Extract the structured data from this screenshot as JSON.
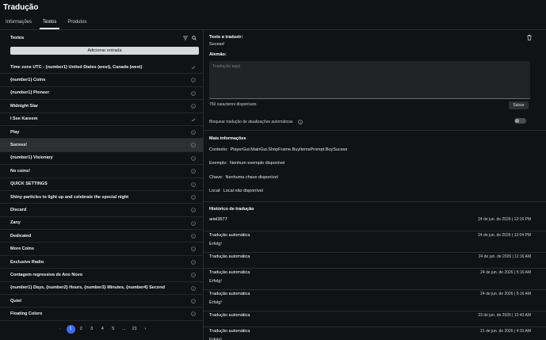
{
  "app": {
    "title": "Tradução"
  },
  "tabs": [
    {
      "label": "Informações"
    },
    {
      "label": "Textos"
    },
    {
      "label": "Produtos"
    }
  ],
  "left": {
    "header": "Textos",
    "add_button": "Adicionar entrada",
    "rows": [
      {
        "label": "Time zone UTC - {number1} United States (west), Canada (west)",
        "icon": "check-icon"
      },
      {
        "label": "{number1} Coins",
        "icon": "info-icon"
      },
      {
        "label": "{number1} Pioneer",
        "icon": "info-icon"
      },
      {
        "label": "Midnight Star",
        "icon": "info-icon"
      },
      {
        "label": "I See Kareem",
        "icon": "check-icon"
      },
      {
        "label": "Play",
        "icon": "info-icon"
      },
      {
        "label": "Sucess!",
        "icon": "info-icon",
        "selected": true
      },
      {
        "label": "{number1} Visionary",
        "icon": "info-icon"
      },
      {
        "label": "No coins!",
        "icon": "info-icon"
      },
      {
        "label": "QUICK SETTINGS",
        "icon": "info-icon"
      },
      {
        "label": "Shiny particles to light up and celebrate the special night",
        "icon": "info-icon"
      },
      {
        "label": "Discard",
        "icon": "info-icon"
      },
      {
        "label": "Zany",
        "icon": "info-icon"
      },
      {
        "label": "Dedicated",
        "icon": "info-icon"
      },
      {
        "label": "More Coins",
        "icon": "info-icon"
      },
      {
        "label": "Exclusive Radio",
        "icon": "info-icon"
      },
      {
        "label": "Contagem regressiva de Ano Novo",
        "icon": "info-icon"
      },
      {
        "label": "{number1} Days, {number2} Hours, {number3} Minutes, {number4} Second",
        "icon": "info-icon"
      },
      {
        "label": "Quiet",
        "icon": "info-icon"
      },
      {
        "label": "Floating Colors",
        "icon": "info-icon"
      }
    ],
    "pagination": {
      "prev": "‹",
      "pages": [
        "1",
        "2",
        "3",
        "4",
        "5",
        "...",
        "21"
      ],
      "next": "›"
    }
  },
  "right": {
    "source_label": "Texto a traduzir:",
    "source_text": "Sucess!",
    "target_label": "Alemão:",
    "textarea_placeholder": "Tradução aqui",
    "chars_available": "750 caracteres disponíveis",
    "save_button": "Salvar",
    "block_label": "Bloquear tradução de atualizações automáticas",
    "more_info_title": "Mais informações",
    "context_label": "Contexto:",
    "context_value": "PlayerGui.MainGui.ShopFrame.BuyItemsPrompt.BuySucess",
    "example_label": "Exemplo:",
    "example_value": "Nenhum exemplo disponível",
    "key_label": "Chave:",
    "key_value": "Nenhuma chave disponível",
    "local_label": "Local:",
    "local_value": "Local não disponível",
    "history_title": "Histórico de tradução",
    "history": [
      {
        "who": "ariel3577",
        "date": "24 de jun. de 2026 | 12:16 PM",
        "text": ""
      },
      {
        "who": "Tradução automática",
        "date": "24 de jun. de 2026 | 12:04 PM",
        "text": "Erfolg!"
      },
      {
        "who": "Tradução automática",
        "date": "24 de jun. de 2026 | 11:16 AM",
        "text": ""
      },
      {
        "who": "Tradução automática",
        "date": "24 de jun. de 2026 | 5:16 AM",
        "text": "Erfolg!"
      },
      {
        "who": "Tradução automática",
        "date": "24 de jun. de 2026 | 5:16 AM",
        "text": "Erfolg!"
      },
      {
        "who": "Tradução automática",
        "date": "23 de jun. de 2026 | 12:43 AM",
        "text": ""
      },
      {
        "who": "Tradução automática",
        "date": "21 de jun. de 2026 | 4:31 AM",
        "text": "Erfolg!"
      }
    ]
  },
  "colors": {
    "background": "#111214",
    "accent": "#3b6cf5",
    "selected_row": "#2e2f33"
  }
}
